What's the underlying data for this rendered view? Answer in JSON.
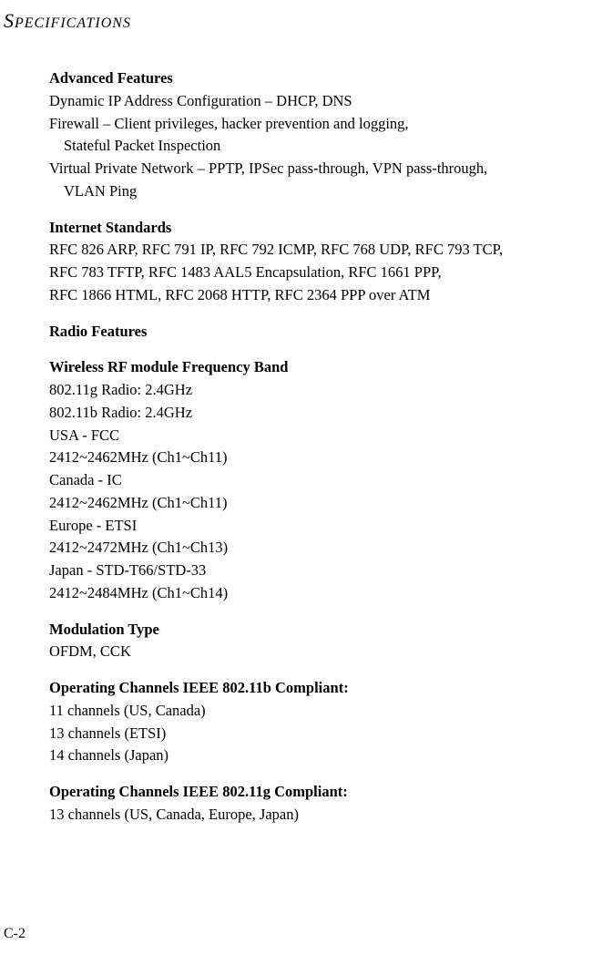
{
  "header": {
    "text": "PECIFICATIONS"
  },
  "sections": {
    "advanced_features": {
      "heading": "Advanced Features",
      "line1": "Dynamic IP Address Configuration – DHCP, DNS",
      "line2": "Firewall – Client privileges, hacker prevention and logging,",
      "line3": "Stateful Packet Inspection",
      "line4": "Virtual Private Network – PPTP, IPSec pass-through, VPN pass-through,",
      "line5": "VLAN Ping"
    },
    "internet_standards": {
      "heading": "Internet Standards",
      "line1": "RFC 826 ARP, RFC 791 IP, RFC 792 ICMP, RFC 768 UDP, RFC 793 TCP,",
      "line2": "RFC 783 TFTP, RFC 1483 AAL5 Encapsulation, RFC 1661 PPP,",
      "line3": "RFC 1866 HTML, RFC 2068 HTTP, RFC 2364 PPP over ATM"
    },
    "radio_features": {
      "heading": "Radio Features"
    },
    "wireless_rf": {
      "heading": "Wireless RF module Frequency Band",
      "line1": "802.11g Radio: 2.4GHz",
      "line2": "802.11b Radio: 2.4GHz",
      "line3": "USA - FCC",
      "line4": "2412~2462MHz (Ch1~Ch11)",
      "line5": "Canada - IC",
      "line6": "2412~2462MHz (Ch1~Ch11)",
      "line7": "Europe - ETSI",
      "line8": "2412~2472MHz (Ch1~Ch13)",
      "line9": "Japan - STD-T66/STD-33",
      "line10": "2412~2484MHz (Ch1~Ch14)"
    },
    "modulation_type": {
      "heading": "Modulation Type",
      "line1": "OFDM, CCK"
    },
    "operating_channels_b": {
      "heading": "Operating Channels IEEE 802.11b Compliant:",
      "line1": "11 channels (US, Canada)",
      "line2": "13 channels (ETSI)",
      "line3": "14 channels (Japan)"
    },
    "operating_channels_g": {
      "heading": "Operating Channels IEEE 802.11g Compliant:",
      "line1": "13 channels (US, Canada, Europe, Japan)"
    }
  },
  "page_number": "C-2"
}
